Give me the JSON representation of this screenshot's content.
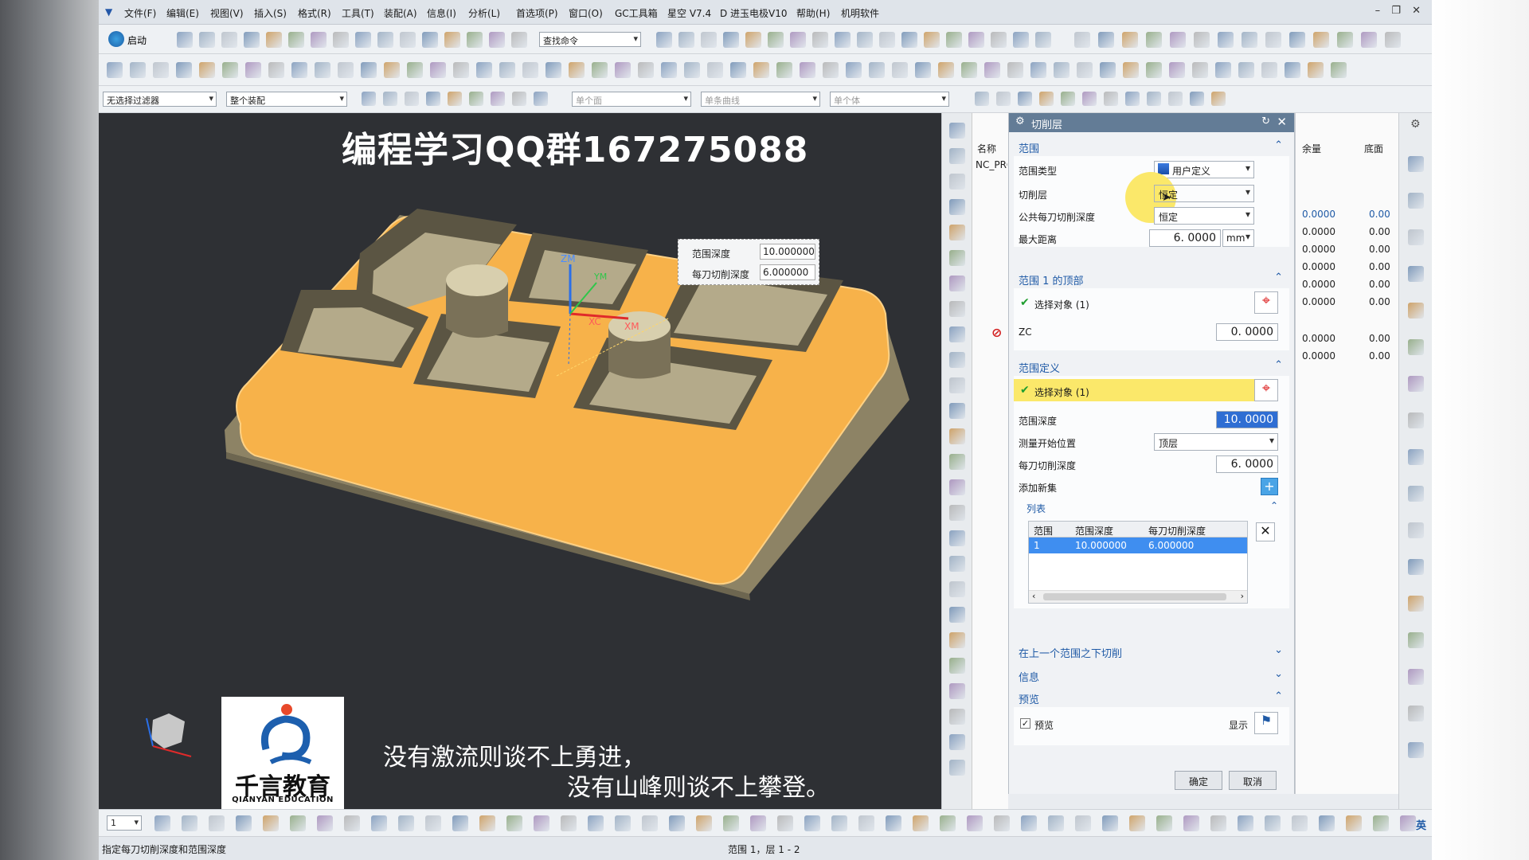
{
  "menu": [
    "文件(F)",
    "编辑(E)",
    "视图(V)",
    "插入(S)",
    "格式(R)",
    "工具(T)",
    "装配(A)",
    "信息(I)",
    "分析(L)",
    "首选项(P)",
    "窗口(O)",
    "GC工具箱",
    "星空 V7.4",
    "D 进玉电极V10",
    "帮助(H)",
    "机明软件"
  ],
  "window_controls": [
    "–",
    "❐",
    "✕"
  ],
  "toolbar": {
    "start_label": "启动",
    "find_command_placeholder": "查找命令",
    "filter_label": "无选择过滤器",
    "assembly_label": "整个装配",
    "single_face_label": "单个面",
    "single_curve_label": "单条曲线",
    "single_body_label": "单个体"
  },
  "viewport": {
    "overlay_title": "编程学习QQ群167275088",
    "axis_labels": {
      "zm": "ZM",
      "ym": "YM",
      "xc": "XC",
      "xm": "XM"
    },
    "dynamic_input": [
      {
        "label": "范围深度",
        "value": "10.000000"
      },
      {
        "label": "每刀切削深度",
        "value": "6.000000"
      }
    ],
    "logo_name": "千言教育",
    "logo_en": "QIANYAN EDUCATION",
    "subtitle_line1": "没有激流则谈不上勇进，",
    "subtitle_line2": "没有山峰则谈不上攀登。"
  },
  "nav_tree": {
    "col_name": "名称",
    "item": "NC_PROGRAM"
  },
  "dialog": {
    "title": "切削层",
    "range": {
      "header": "范围",
      "range_type_label": "范围类型",
      "range_type_value": "用户定义",
      "cut_levels_label": "切削层",
      "cut_levels_value": "恒定",
      "common_depth_label": "公共每刀切削深度",
      "common_depth_value": "恒定",
      "max_distance_label": "最大距离",
      "max_distance_value": "6. 0000",
      "max_distance_unit": "mm"
    },
    "range1_top": {
      "header": "范围 1 的顶部",
      "select_label": "选择对象 (1)",
      "zc_label": "ZC",
      "zc_value": "0. 0000"
    },
    "range_def": {
      "header": "范围定义",
      "select_label": "选择对象 (1)",
      "depth_label": "范围深度",
      "depth_value": "10. 0000",
      "measure_label": "测量开始位置",
      "measure_value": "顶层",
      "per_cut_label": "每刀切削深度",
      "per_cut_value": "6. 0000",
      "add_new_label": "添加新集"
    },
    "list": {
      "header": "列表",
      "columns": [
        "范围",
        "范围深度",
        "每刀切削深度"
      ],
      "rows": [
        [
          "1",
          "10.000000",
          "6.000000"
        ]
      ]
    },
    "cut_below_header": "在上一个范围之下切削",
    "info_header": "信息",
    "preview": {
      "header": "预览",
      "checkbox_label": "预览",
      "show_label": "显示"
    },
    "ok_label": "确定",
    "cancel_label": "取消"
  },
  "right_panel": {
    "col_remain": "余量",
    "col_bottom": "底面",
    "rows": [
      [
        "0.0000",
        "0.00"
      ],
      [
        "0.0000",
        "0.00"
      ],
      [
        "0.0000",
        "0.00"
      ],
      [
        "0.0000",
        "0.00"
      ],
      [
        "0.0000",
        "0.00"
      ],
      [
        "0.0000",
        "0.00"
      ],
      [
        "0.0000",
        "0.00"
      ],
      [
        "0.0000",
        "0.00"
      ]
    ]
  },
  "bottom_toolbar": {
    "layer_value": "1",
    "ime": "英"
  },
  "status": {
    "hint": "指定每刀切削深度和范围深度",
    "range_info": "范围 1，层 1 - 2"
  },
  "colors": {
    "accent": "#1f5aa6",
    "highlight": "#fbe86a",
    "part_top": "#f7b24a",
    "part_body": "#8d8365"
  }
}
